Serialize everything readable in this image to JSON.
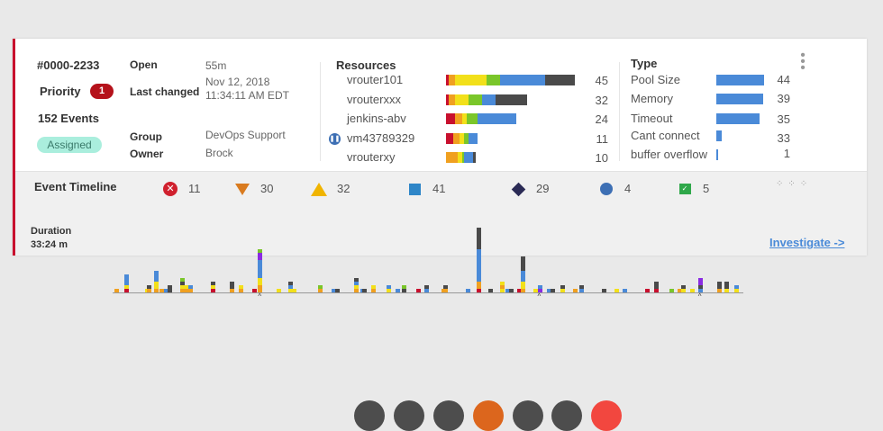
{
  "incident": {
    "id": "#0000-2233",
    "priority_label": "Priority",
    "priority": "1",
    "events": "152 Events",
    "status": "Assigned"
  },
  "details": {
    "open_label": "Open",
    "open": "55m",
    "changed_label": "Last changed",
    "changed_date": "Nov 12, 2018",
    "changed_time": "11:34:11 AM EDT",
    "group_label": "Group",
    "group": "DevOps Support",
    "owner_label": "Owner",
    "owner": "Brock"
  },
  "resources": {
    "title": "Resources",
    "items": [
      {
        "name": "vrouter101",
        "count": "45",
        "segments": [
          [
            "r",
            1
          ],
          [
            "o",
            3
          ],
          [
            "y",
            14
          ],
          [
            "g",
            6
          ],
          [
            "b",
            20
          ],
          [
            "k",
            13
          ]
        ]
      },
      {
        "name": "vrouterxxx",
        "count": "32",
        "segments": [
          [
            "r",
            1
          ],
          [
            "o",
            3
          ],
          [
            "y",
            6
          ],
          [
            "g",
            6
          ],
          [
            "b",
            6
          ],
          [
            "k",
            14
          ]
        ]
      },
      {
        "name": "jenkins-abv",
        "count": "24",
        "segments": [
          [
            "r",
            4
          ],
          [
            "o",
            3
          ],
          [
            "y",
            2
          ],
          [
            "g",
            5
          ],
          [
            "b",
            17
          ]
        ]
      },
      {
        "name": "vm43789329",
        "count": "11",
        "segments": [
          [
            "r",
            3
          ],
          [
            "o",
            3
          ],
          [
            "y",
            2
          ],
          [
            "g",
            2
          ],
          [
            "b",
            4
          ]
        ],
        "paused": true
      },
      {
        "name": "vrouterxy",
        "count": "10",
        "segments": [
          [
            "o",
            5
          ],
          [
            "y",
            2
          ],
          [
            "g",
            1
          ],
          [
            "b",
            4
          ],
          [
            "k",
            1
          ]
        ]
      }
    ]
  },
  "types": {
    "title": "Type",
    "items": [
      {
        "name": "Pool Size",
        "count": "44",
        "value": 44
      },
      {
        "name": "Memory",
        "count": "39",
        "value": 43
      },
      {
        "name": "Timeout",
        "count": "35",
        "value": 40
      },
      {
        "name": "Cant connect",
        "count": "33",
        "value": 5
      },
      {
        "name": "buffer overflow",
        "count": "1",
        "value": 2
      }
    ]
  },
  "timeline": {
    "title": "Event Timeline",
    "duration_label": "Duration",
    "duration": "33:24 m",
    "investigate": "Investigate ->",
    "stats": [
      {
        "icon": "critical-icon",
        "count": "11"
      },
      {
        "icon": "major-icon",
        "count": "30"
      },
      {
        "icon": "warning-icon",
        "count": "32"
      },
      {
        "icon": "info-icon",
        "count": "41"
      },
      {
        "icon": "unknown-icon",
        "count": "29"
      },
      {
        "icon": "paused-icon",
        "count": "4"
      },
      {
        "icon": "resolved-icon",
        "count": "5"
      }
    ],
    "duration_min": 33.4,
    "markers_min": [
      7.7,
      22.5,
      31.0
    ],
    "events": [
      [
        0.1,
        "o1"
      ],
      [
        0.6,
        "r1y1b3"
      ],
      [
        1.7,
        "y1"
      ],
      [
        1.8,
        "o1k1"
      ],
      [
        2.2,
        "o1y2b3"
      ],
      [
        2.5,
        "o1"
      ],
      [
        2.7,
        "b1"
      ],
      [
        2.9,
        "k2"
      ],
      [
        3.6,
        "o1y1k1g1"
      ],
      [
        3.8,
        "o1y1"
      ],
      [
        4.0,
        "o1b1"
      ],
      [
        5.2,
        "r1y1k1"
      ],
      [
        6.2,
        "o1k2"
      ],
      [
        6.7,
        "o1y1"
      ],
      [
        7.4,
        "r1"
      ],
      [
        7.7,
        "o2y2b5p2g1"
      ],
      [
        8.7,
        "y1"
      ],
      [
        9.3,
        "y1b1k1"
      ],
      [
        9.5,
        "y1"
      ],
      [
        10.9,
        "o1g1"
      ],
      [
        11.6,
        "b1"
      ],
      [
        11.8,
        "k1"
      ],
      [
        12.8,
        "o1y1b1k1"
      ],
      [
        13.1,
        "b1"
      ],
      [
        13.2,
        "k1"
      ],
      [
        13.7,
        "o1y1"
      ],
      [
        14.5,
        "y1b1"
      ],
      [
        15.0,
        "b1"
      ],
      [
        15.3,
        "k1g1"
      ],
      [
        16.1,
        "r1"
      ],
      [
        16.5,
        "b1k1"
      ],
      [
        17.4,
        "o1"
      ],
      [
        17.5,
        "o1k1"
      ],
      [
        18.7,
        "b1"
      ],
      [
        19.3,
        "r1o2b9k6"
      ],
      [
        19.9,
        "k1"
      ],
      [
        20.5,
        "y1o1y1"
      ],
      [
        20.8,
        "b1"
      ],
      [
        21.0,
        "k1"
      ],
      [
        21.4,
        "r1"
      ],
      [
        21.6,
        "o1y2b3k4"
      ],
      [
        22.3,
        "y1"
      ],
      [
        22.5,
        "p1b1"
      ],
      [
        23.0,
        "b1"
      ],
      [
        23.2,
        "k1"
      ],
      [
        23.7,
        "y1k1"
      ],
      [
        24.4,
        "o1"
      ],
      [
        24.7,
        "b1k1"
      ],
      [
        25.9,
        "k1"
      ],
      [
        26.6,
        "y1"
      ],
      [
        27.0,
        "b1"
      ],
      [
        28.2,
        "r1"
      ],
      [
        28.7,
        "r1k2"
      ],
      [
        29.5,
        "g1"
      ],
      [
        29.9,
        "o1"
      ],
      [
        30.1,
        "y1k1"
      ],
      [
        30.6,
        "y1"
      ],
      [
        31.0,
        "b1k1p2"
      ],
      [
        32.0,
        "o1k2"
      ],
      [
        32.4,
        "y1k2"
      ],
      [
        32.9,
        "y1b1"
      ]
    ]
  },
  "colors": {
    "r": "#c8102e",
    "o": "#f0a020",
    "y": "#f2e01a",
    "g": "#7ac62a",
    "b": "#4a8ad8",
    "k": "#4a4a4a",
    "p": "#8a2be2"
  }
}
